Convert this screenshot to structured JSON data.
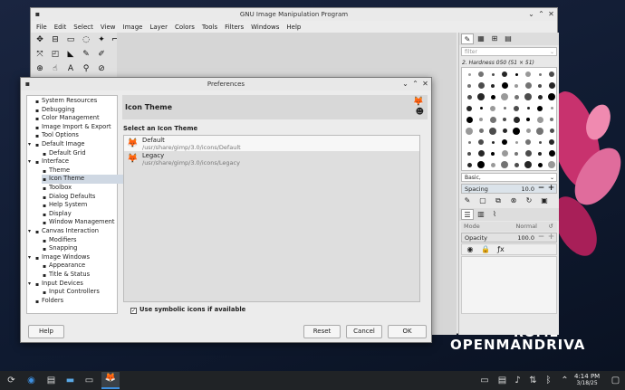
{
  "gimp": {
    "title": "GNU Image Manipulation Program",
    "menu": [
      "File",
      "Edit",
      "Select",
      "View",
      "Image",
      "Layer",
      "Colors",
      "Tools",
      "Filters",
      "Windows",
      "Help"
    ],
    "brushes": {
      "filter_placeholder": "filter",
      "current_brush": "2. Hardness 050 (51 × 51)",
      "preset": "Basic,",
      "spacing_label": "Spacing",
      "spacing_value": "10.0"
    },
    "layers": {
      "mode_label": "Mode",
      "mode_value": "Normal",
      "opacity_label": "Opacity",
      "opacity_value": "100.0"
    }
  },
  "dialog": {
    "title": "Preferences",
    "section_title": "Icon Theme",
    "list_label": "Select an Icon Theme",
    "themes": [
      {
        "name": "Default",
        "path": "/usr/share/gimp/3.0/icons/Default"
      },
      {
        "name": "Legacy",
        "path": "/usr/share/gimp/3.0/icons/Legacy"
      }
    ],
    "checkbox_label": "Use symbolic icons if available",
    "checkbox_checked": true,
    "tree": [
      "System Resources",
      "Debugging",
      "Color Management",
      "Image Import & Export",
      "Tool Options",
      "Default Image",
      "Default Grid",
      "Interface",
      "Theme",
      "Icon Theme",
      "Toolbox",
      "Dialog Defaults",
      "Help System",
      "Display",
      "Window Management",
      "Canvas Interaction",
      "Modifiers",
      "Snapping",
      "Image Windows",
      "Appearance",
      "Title & Status",
      "Input Devices",
      "Input Controllers",
      "Folders"
    ],
    "buttons": {
      "help": "Help",
      "reset": "Reset",
      "cancel": "Cancel",
      "ok": "OK"
    }
  },
  "desktop": {
    "brand_top": "ROME",
    "brand_bottom": "OPENMANDRIVA"
  },
  "taskbar": {
    "time": "4:14 PM",
    "date": "3/18/25"
  }
}
